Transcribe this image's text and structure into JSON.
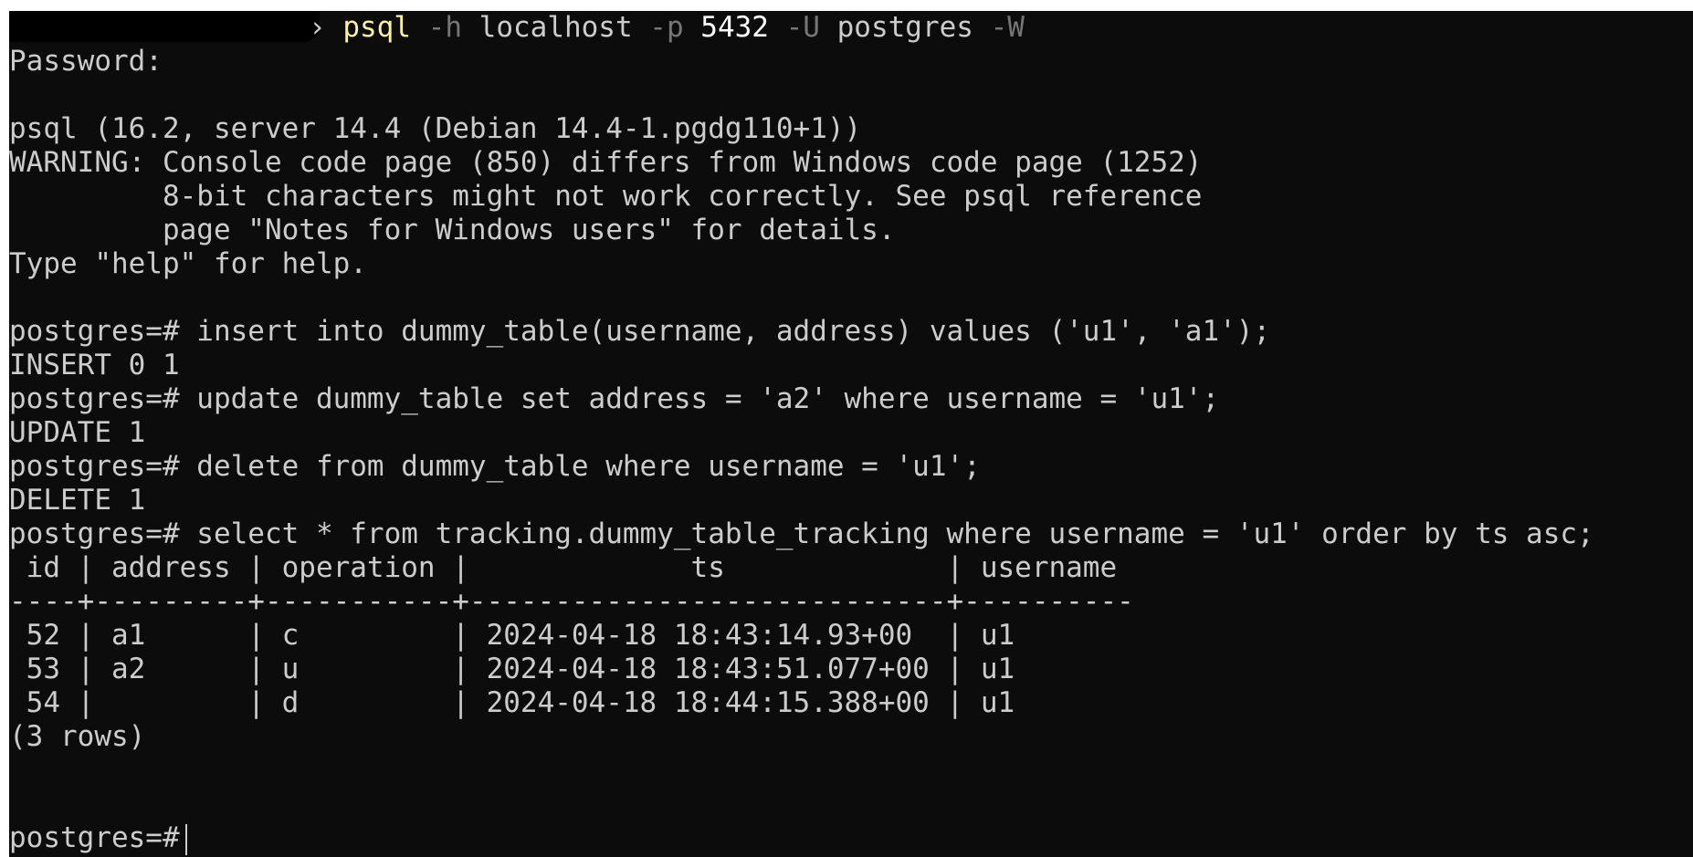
{
  "command": {
    "arrow": "›",
    "program": "psql",
    "tokens": [
      {
        "text": " -h",
        "kind": "flag"
      },
      {
        "text": " localhost",
        "kind": "arg"
      },
      {
        "text": " -p",
        "kind": "flag"
      },
      {
        "text": " 5432",
        "kind": "num"
      },
      {
        "text": " -U",
        "kind": "flag"
      },
      {
        "text": " postgres",
        "kind": "arg"
      },
      {
        "text": " -W",
        "kind": "flag"
      }
    ]
  },
  "output_lines": [
    "Password:",
    "",
    "psql (16.2, server 14.4 (Debian 14.4-1.pgdg110+1))",
    "WARNING: Console code page (850) differs from Windows code page (1252)",
    "         8-bit characters might not work correctly. See psql reference",
    "         page \"Notes for Windows users\" for details.",
    "Type \"help\" for help.",
    "",
    "postgres=# insert into dummy_table(username, address) values ('u1', 'a1');",
    "INSERT 0 1",
    "postgres=# update dummy_table set address = 'a2' where username = 'u1';",
    "UPDATE 1",
    "postgres=# delete from dummy_table where username = 'u1';",
    "DELETE 1",
    "postgres=# select * from tracking.dummy_table_tracking where username = 'u1' order by ts asc;",
    " id | address | operation |             ts             | username",
    "----+---------+-----------+----------------------------+----------",
    " 52 | a1      | c         | 2024-04-18 18:43:14.93+00  | u1",
    " 53 | a2      | u         | 2024-04-18 18:43:51.077+00 | u1",
    " 54 |         | d         | 2024-04-18 18:44:15.388+00 | u1",
    "(3 rows)",
    "",
    ""
  ],
  "final_prompt": "postgres=#",
  "colors": {
    "background": "#0c0c0c",
    "text": "#cccccc",
    "command": "#f9f1a5",
    "flag": "#767676",
    "number": "#ffffff"
  }
}
